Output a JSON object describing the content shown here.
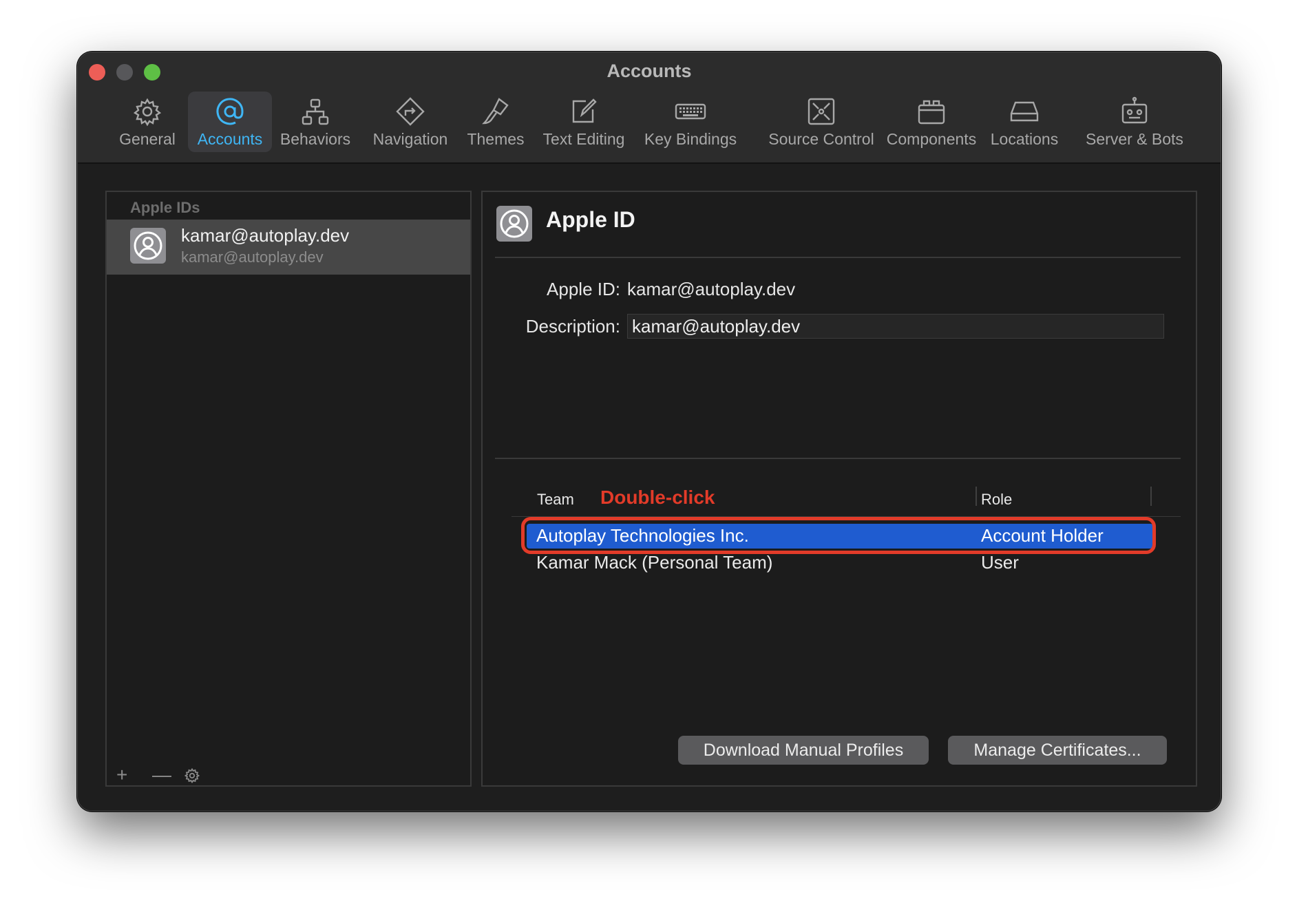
{
  "window": {
    "title": "Accounts"
  },
  "toolbar": {
    "items": [
      {
        "label": "General",
        "icon": "gear-icon"
      },
      {
        "label": "Accounts",
        "icon": "at-sign-icon",
        "active": true
      },
      {
        "label": "Behaviors",
        "icon": "hierarchy-icon"
      },
      {
        "label": "Navigation",
        "icon": "navigation-diamond-icon"
      },
      {
        "label": "Themes",
        "icon": "brush-icon"
      },
      {
        "label": "Text Editing",
        "icon": "edit-pencil-icon"
      },
      {
        "label": "Key Bindings",
        "icon": "keyboard-icon"
      },
      {
        "label": "Source Control",
        "icon": "source-control-icon"
      },
      {
        "label": "Components",
        "icon": "components-box-icon"
      },
      {
        "label": "Locations",
        "icon": "disk-drive-icon"
      },
      {
        "label": "Server & Bots",
        "icon": "robot-icon"
      }
    ],
    "active_color": "#3fb6f5"
  },
  "sidebar": {
    "header": "Apple IDs",
    "accounts": [
      {
        "name": "kamar@autoplay.dev",
        "subtitle": "kamar@autoplay.dev"
      }
    ],
    "controls": {
      "add": "+",
      "remove": "—",
      "settings_icon": "gear-icon"
    }
  },
  "detail": {
    "title": "Apple ID",
    "apple_id_label": "Apple ID:",
    "apple_id_value": "kamar@autoplay.dev",
    "description_label": "Description:",
    "description_value": "kamar@autoplay.dev",
    "teams_table": {
      "columns": [
        "Team",
        "Role"
      ],
      "rows": [
        {
          "team": "Autoplay Technologies Inc.",
          "role": "Account Holder",
          "selected": true
        },
        {
          "team": "Kamar Mack (Personal Team)",
          "role": "User"
        }
      ]
    },
    "annotation": "Double-click",
    "buttons": {
      "download": "Download Manual Profiles",
      "manage": "Manage Certificates..."
    }
  },
  "colors": {
    "selection": "#1f5cd0",
    "annotation": "#e23b29"
  }
}
